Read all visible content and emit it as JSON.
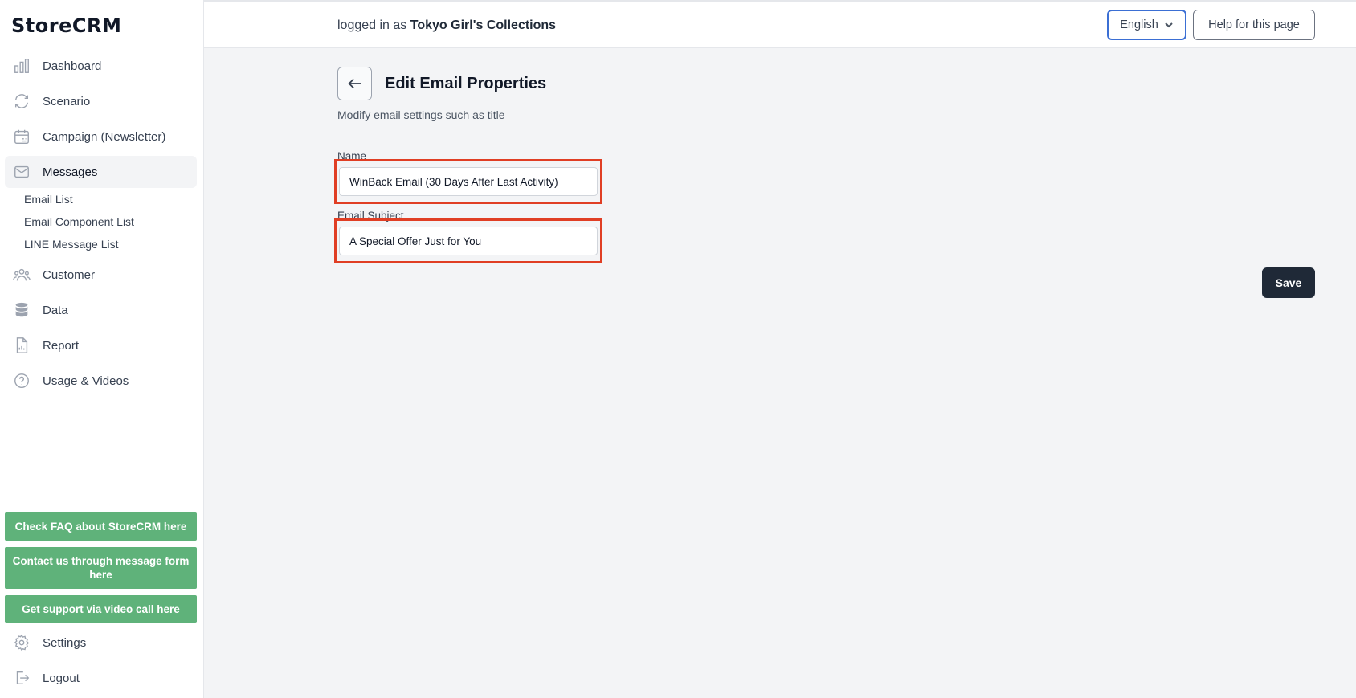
{
  "app": {
    "logo": "StoreCRM"
  },
  "sidebar": {
    "items": [
      {
        "label": "Dashboard",
        "icon": "bar-chart-icon"
      },
      {
        "label": "Scenario",
        "icon": "refresh-icon"
      },
      {
        "label": "Campaign (Newsletter)",
        "icon": "calendar-icon"
      },
      {
        "label": "Messages",
        "icon": "mail-icon",
        "active": true
      },
      {
        "label": "Customer",
        "icon": "users-icon"
      },
      {
        "label": "Data",
        "icon": "database-icon"
      },
      {
        "label": "Report",
        "icon": "document-chart-icon"
      },
      {
        "label": "Usage & Videos",
        "icon": "question-circle-icon"
      }
    ],
    "subitems": [
      "Email List",
      "Email Component List",
      "LINE Message List"
    ],
    "support_buttons": [
      "Check FAQ about StoreCRM here",
      "Contact us through message form here",
      "Get support via video call here"
    ],
    "bottom_items": [
      {
        "label": "Settings",
        "icon": "gear-icon"
      },
      {
        "label": "Logout",
        "icon": "logout-icon"
      }
    ]
  },
  "header": {
    "logged_in_prefix": "logged in as",
    "store_name": "Tokyo Girl's Collections",
    "language": "English",
    "help_label": "Help for this page"
  },
  "main": {
    "title": "Edit Email Properties",
    "subtitle": "Modify email settings such as title",
    "fields": {
      "name_label": "Name",
      "name_value": "WinBack Email (30 Days After Last Activity)",
      "subject_label": "Email Subject",
      "subject_value": "A Special Offer Just for You"
    },
    "save_label": "Save"
  },
  "colors": {
    "accent_dark": "#1f2937",
    "support_green": "#5fb27a",
    "highlight_red": "#e03e24",
    "focus_blue": "#3b6fd4"
  }
}
